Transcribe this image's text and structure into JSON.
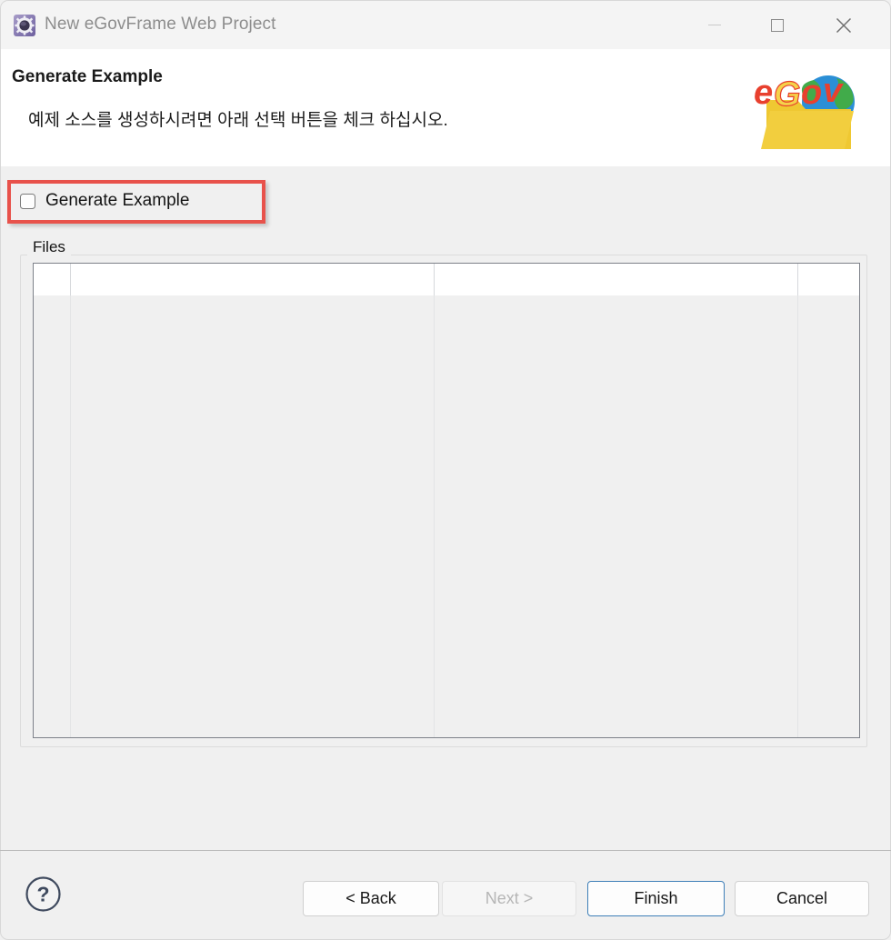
{
  "window": {
    "title": "New eGovFrame Web Project",
    "icon": "gear-icon",
    "controls": {
      "minimize": "minimize-icon",
      "maximize": "maximize-icon",
      "close": "close-icon"
    }
  },
  "header": {
    "title": "Generate Example",
    "subtitle": "예제 소스를 생성하시려면 아래 선택 버튼을 체크 하십시오.",
    "logo_text": "eGov",
    "logo_alt": "egov-logo"
  },
  "main": {
    "checkbox": {
      "label": "Generate Example",
      "checked": false
    },
    "annotation": {
      "color": "#e8524b",
      "target": "generate-example-checkbox"
    },
    "files_group": {
      "label": "Files",
      "table": {
        "columns": [
          "",
          "",
          "",
          ""
        ],
        "rows": []
      }
    }
  },
  "footer": {
    "help": "?",
    "buttons": {
      "back": "< Back",
      "next": "Next >",
      "finish": "Finish",
      "cancel": "Cancel"
    },
    "finish_accent": "#3e7fb8"
  }
}
